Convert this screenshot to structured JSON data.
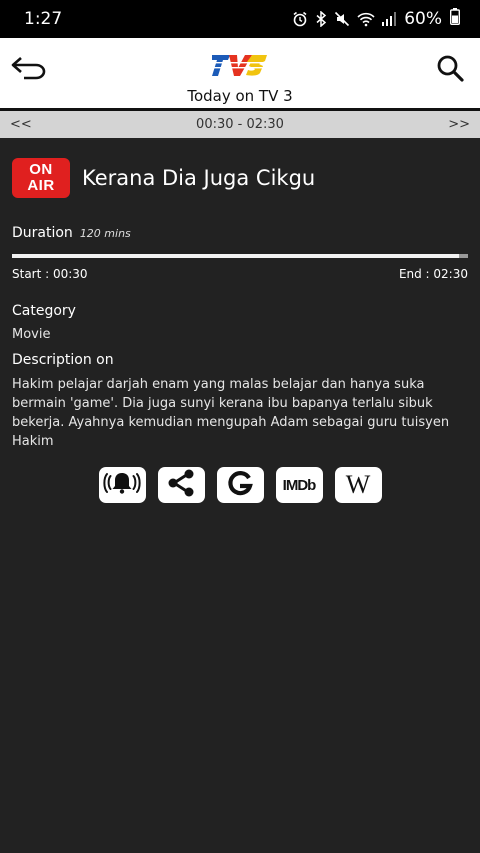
{
  "status_bar": {
    "time": "1:27",
    "battery": "60%",
    "icons": [
      "alarm-icon",
      "bluetooth-icon",
      "mute-icon",
      "wifi-icon",
      "signal-icon",
      "battery-icon"
    ]
  },
  "header": {
    "title": "Today on TV 3",
    "back_icon": "back-arrow-icon",
    "search_icon": "search-icon",
    "logo": "tv3-logo"
  },
  "time_nav": {
    "prev": "<<",
    "range": "00:30 - 02:30",
    "next": ">>"
  },
  "program": {
    "badge_line1": "ON",
    "badge_line2": "AIR",
    "title": "Kerana Dia Juga Cikgu",
    "duration_label": "Duration",
    "duration_value": "120 mins",
    "progress": 0.98,
    "start": "Start : 00:30",
    "end": "End : 02:30",
    "category_label": "Category",
    "category": "Movie",
    "description_label": "Description on",
    "description": "Hakim pelajar darjah enam yang malas belajar dan hanya suka bermain 'game'. Dia juga sunyi kerana ibu bapanya terlalu sibuk bekerja. Ayahnya kemudian mengupah Adam sebagai guru tuisyen Hakim"
  },
  "actions": [
    {
      "name": "reminder-button",
      "icon": "bell-icon"
    },
    {
      "name": "share-button",
      "icon": "share-icon"
    },
    {
      "name": "google-button",
      "icon": "google-icon",
      "label": "G"
    },
    {
      "name": "imdb-button",
      "icon": "imdb-icon",
      "label": "IMDb"
    },
    {
      "name": "wikipedia-button",
      "icon": "wikipedia-icon",
      "label": "W"
    }
  ],
  "colors": {
    "background": "#222222",
    "on_air": "#e0201f",
    "header_bg": "#ffffff",
    "nav_bar": "#d4d4d4"
  }
}
